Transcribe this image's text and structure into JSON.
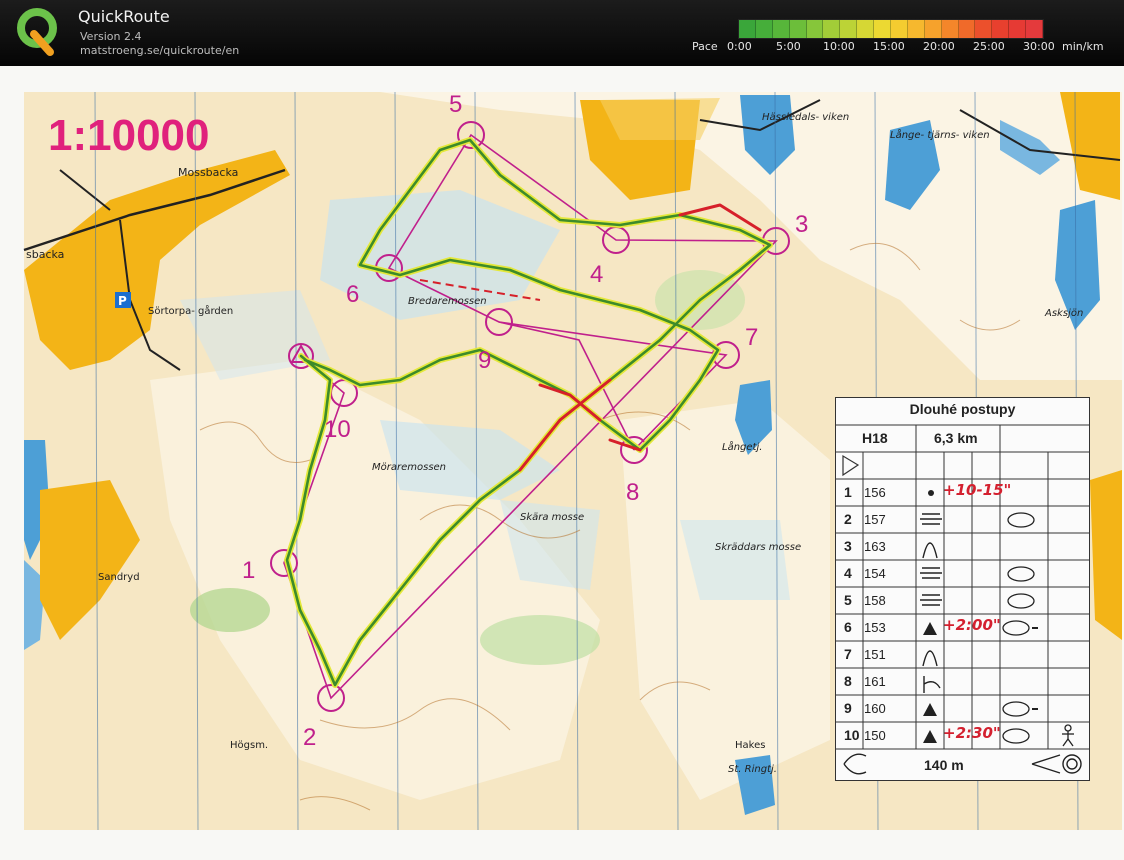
{
  "app": {
    "title": "QuickRoute",
    "version": "Version 2.4",
    "url": "matstroeng.se/quickroute/en"
  },
  "pace_scale": {
    "label": "Pace",
    "ticks": [
      "0:00",
      "5:00",
      "10:00",
      "15:00",
      "20:00",
      "25:00",
      "30:00"
    ],
    "unit": "min/km",
    "colors": [
      "#3aa63a",
      "#46ae3a",
      "#57b63a",
      "#6cbe3a",
      "#86c63a",
      "#a2cd38",
      "#bcd336",
      "#d6d734",
      "#ecd932",
      "#f4cc30",
      "#f6b82e",
      "#f6a22c",
      "#f4862a",
      "#f06a2a",
      "#ec502c",
      "#e8402e",
      "#e63a34",
      "#e43a3c"
    ]
  },
  "map": {
    "scale_text": "1:10000",
    "place_names": [
      "Mossbacka",
      "sbacka",
      "Sörtorpa-\ngården",
      "Bredaremossen",
      "Möraremossen",
      "Sandryd",
      "Högsm.",
      "Skära\nmosse",
      "Skräddars\nmosse",
      "Hässledals-\nviken",
      "Långe-\ntjärns-\nviken",
      "Asksjön",
      "Långetj.",
      "Hakes",
      "St. Ringtj.",
      "P"
    ],
    "control_labels": [
      "1",
      "2",
      "3",
      "4",
      "5",
      "6",
      "7",
      "8",
      "9",
      "10"
    ]
  },
  "legend": {
    "title": "Dlouhé postupy",
    "class": "H18",
    "length": "6,3 km",
    "rows": [
      {
        "num": "1",
        "code": "156",
        "note": "+10-15\""
      },
      {
        "num": "2",
        "code": "157",
        "note": ""
      },
      {
        "num": "3",
        "code": "163",
        "note": ""
      },
      {
        "num": "4",
        "code": "154",
        "note": ""
      },
      {
        "num": "5",
        "code": "158",
        "note": ""
      },
      {
        "num": "6",
        "code": "153",
        "note": "+2:00\""
      },
      {
        "num": "7",
        "code": "151",
        "note": ""
      },
      {
        "num": "8",
        "code": "161",
        "note": ""
      },
      {
        "num": "9",
        "code": "160",
        "note": ""
      },
      {
        "num": "10",
        "code": "150",
        "note": "+2:30\""
      }
    ],
    "finish_distance": "140 m"
  }
}
